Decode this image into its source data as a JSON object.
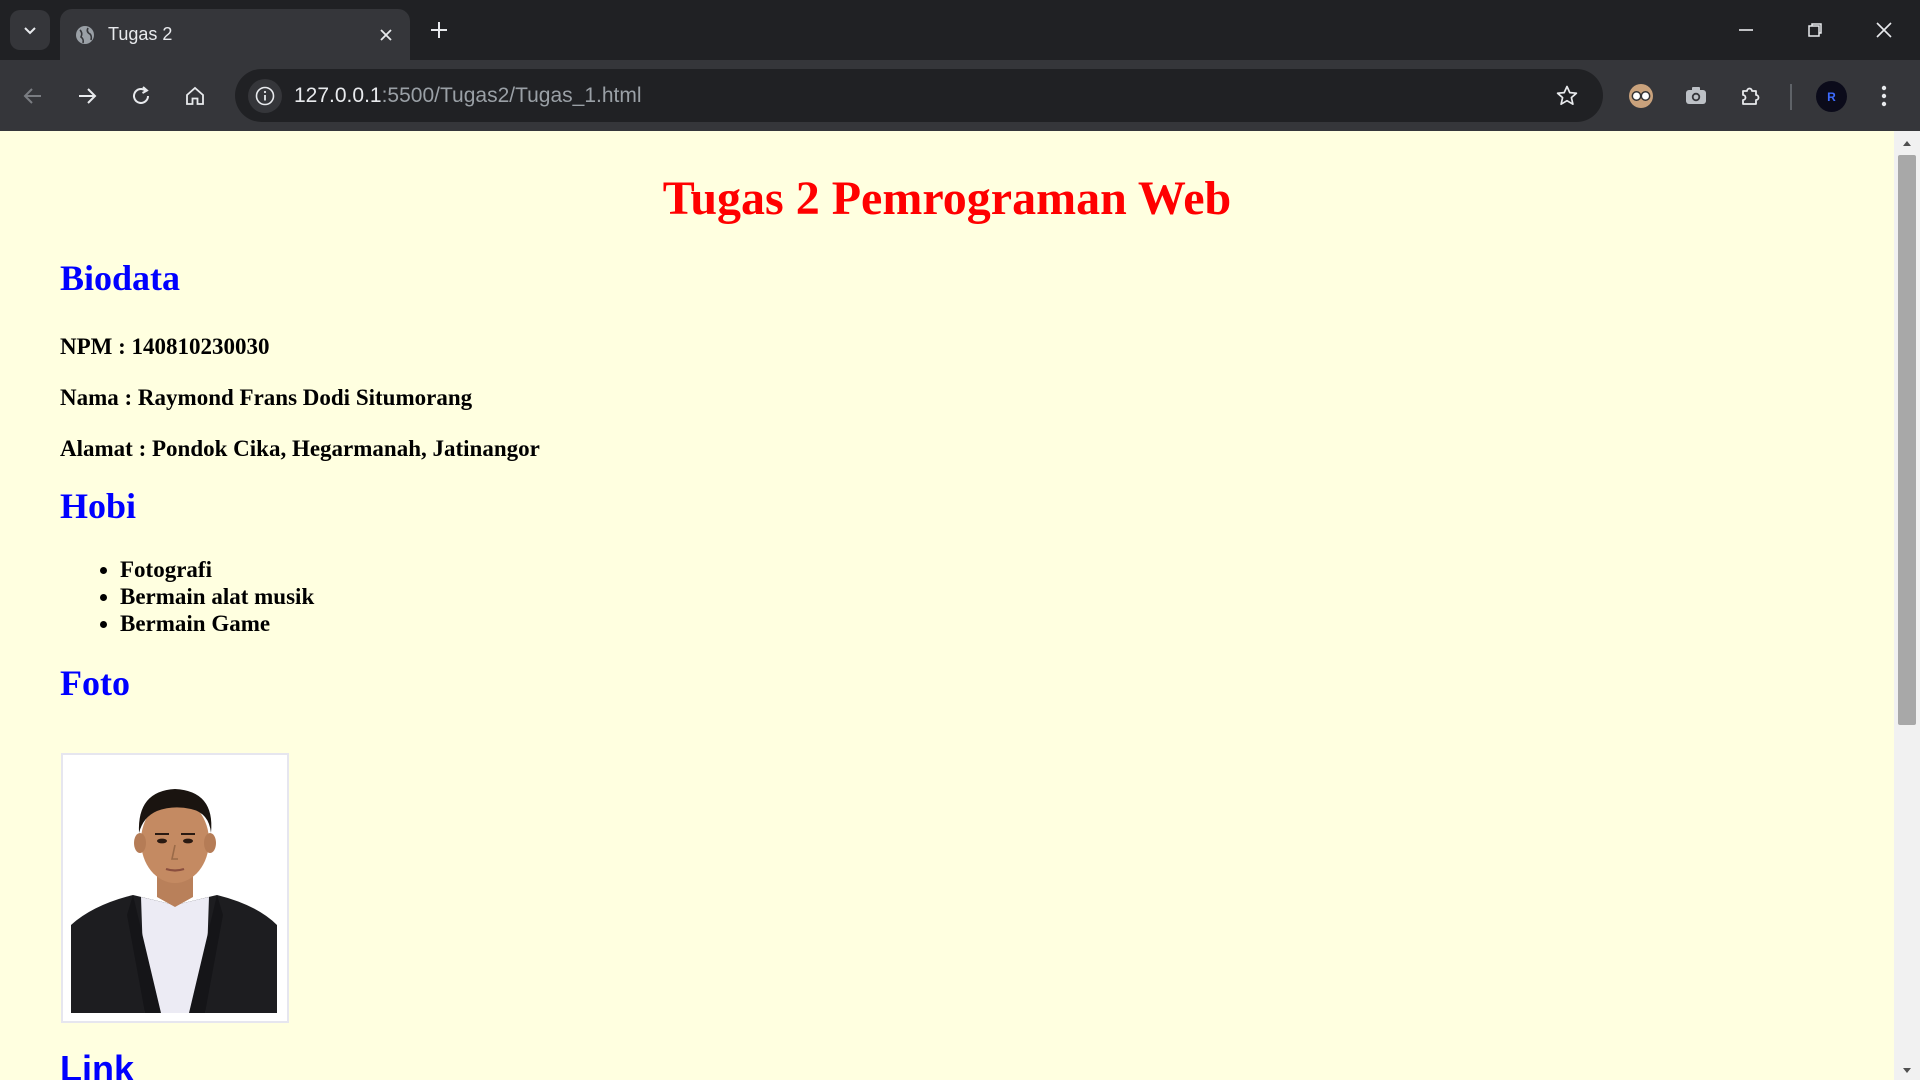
{
  "browser": {
    "tab_title": "Tugas 2",
    "url_host": "127.0.0.1",
    "url_rest": ":5500/Tugas2/Tugas_1.html",
    "profile_initial": "R"
  },
  "page": {
    "title": "Tugas 2 Pemrograman Web",
    "biodata_heading": "Biodata",
    "npm": "NPM : 140810230030",
    "nama": "Nama : Raymond Frans Dodi Situmorang",
    "alamat": "Alamat : Pondok Cika, Hegarmanah, Jatinangor",
    "hobi_heading": "Hobi",
    "hobi": [
      "Fotografi",
      "Bermain alat musik",
      "Bermain Game"
    ],
    "foto_heading": "Foto",
    "link_heading": "Link"
  },
  "colors": {
    "page_bg": "#ffffe0",
    "title_color": "#ff0000",
    "heading_color": "#0000ff"
  }
}
